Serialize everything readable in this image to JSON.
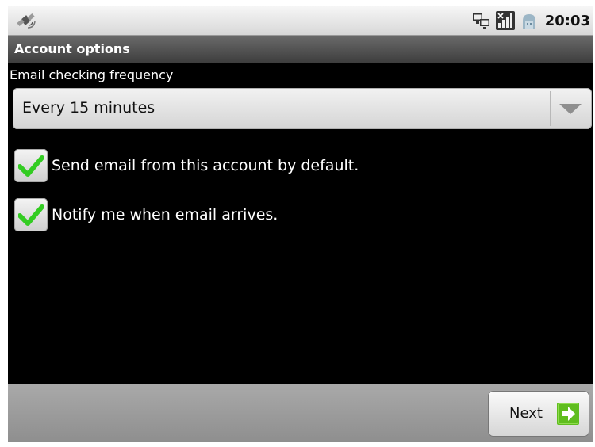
{
  "status_bar": {
    "left_icon": "satellite-icon",
    "right_icons": [
      "network-icon",
      "signal-icon",
      "usb-icon"
    ],
    "time": "20:03"
  },
  "title_bar": {
    "title": "Account options"
  },
  "frequency": {
    "label": "Email checking frequency",
    "selected": "Every 15 minutes"
  },
  "options": [
    {
      "label": "Send email from this account by default.",
      "checked": true
    },
    {
      "label": "Notify me when email arrives.",
      "checked": true
    }
  ],
  "footer": {
    "next_label": "Next",
    "next_icon": "arrow-right-icon"
  },
  "colors": {
    "check_green": "#33cc22",
    "next_icon_green": "#5fbd1e"
  }
}
